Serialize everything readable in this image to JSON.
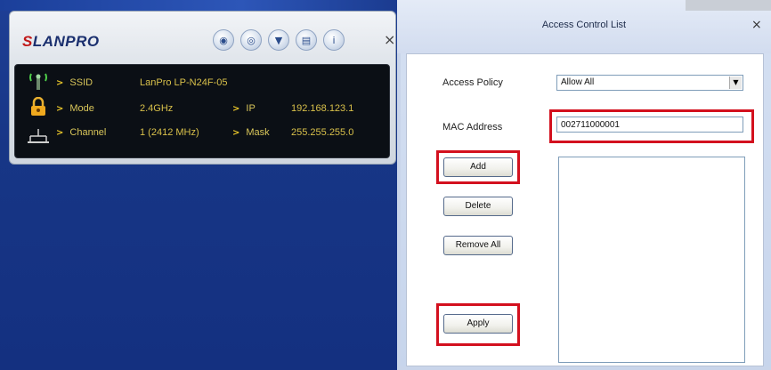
{
  "lanpro": {
    "logo_mark": "S",
    "logo_text": "LANPRO",
    "toolbar_icons": [
      "network-icon",
      "profile-icon",
      "signal-icon",
      "settings-icon",
      "info-icon"
    ],
    "close_glyph": "×",
    "status": {
      "ssid_label": "SSID",
      "ssid_value": "LanPro LP-N24F-05",
      "mode_label": "Mode",
      "mode_value": "2.4GHz",
      "channel_label": "Channel",
      "channel_value": "1 (2412 MHz)",
      "ip_label": "IP",
      "ip_value": "192.168.123.1",
      "mask_label": "Mask",
      "mask_value": "255.255.255.0"
    }
  },
  "acl": {
    "title": "Access Control List",
    "close_glyph": "×",
    "access_policy_label": "Access Policy",
    "access_policy_value": "Allow All",
    "mac_label": "MAC Address",
    "mac_value": "002711000001",
    "add_label": "Add",
    "delete_label": "Delete",
    "remove_all_label": "Remove All",
    "apply_label": "Apply",
    "mac_list": []
  },
  "colors": {
    "highlight": "#d3101e",
    "desktop_blue": "#173686",
    "status_text": "#d8c04a"
  }
}
